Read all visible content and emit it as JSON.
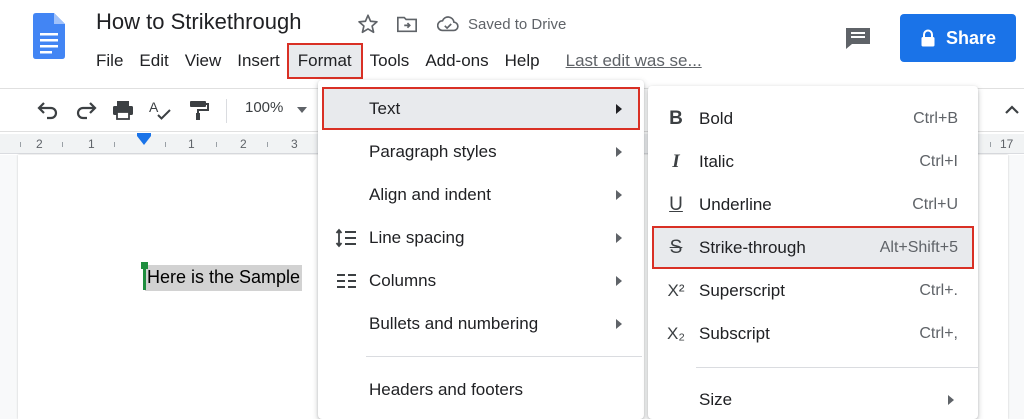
{
  "header": {
    "doc_title": "How to Strikethrough",
    "saved_status": "Saved to Drive",
    "share_label": "Share",
    "last_edit": "Last edit was se..."
  },
  "menubar": {
    "items": [
      "File",
      "Edit",
      "View",
      "Insert",
      "Format",
      "Tools",
      "Add-ons",
      "Help"
    ],
    "active": "Format"
  },
  "toolbar": {
    "zoom": "100%",
    "icons": [
      "undo-icon",
      "redo-icon",
      "print-icon",
      "spellcheck-icon",
      "paint-format-icon"
    ]
  },
  "ruler": {
    "numbers": [
      "2",
      "1",
      "1",
      "2",
      "3",
      "17"
    ]
  },
  "document": {
    "text": "Here is the Sample"
  },
  "format_menu": {
    "items": [
      {
        "label": "Text",
        "icon": "",
        "submenu": true,
        "highlighted": true
      },
      {
        "label": "Paragraph styles",
        "icon": "",
        "submenu": true
      },
      {
        "label": "Align and indent",
        "icon": "",
        "submenu": true
      },
      {
        "label": "Line spacing",
        "icon": "line-spacing-icon",
        "submenu": true
      },
      {
        "label": "Columns",
        "icon": "columns-icon",
        "submenu": true
      },
      {
        "label": "Bullets and numbering",
        "icon": "",
        "submenu": true
      },
      {
        "label": "Headers and footers",
        "icon": "",
        "submenu": false
      }
    ]
  },
  "text_menu": {
    "items": [
      {
        "label": "Bold",
        "glyph": "B",
        "shortcut": "Ctrl+B"
      },
      {
        "label": "Italic",
        "glyph": "I",
        "shortcut": "Ctrl+I"
      },
      {
        "label": "Underline",
        "glyph": "U",
        "shortcut": "Ctrl+U"
      },
      {
        "label": "Strike-through",
        "glyph": "S",
        "shortcut": "Alt+Shift+5",
        "highlighted": true
      },
      {
        "label": "Superscript",
        "glyph": "X²",
        "shortcut": "Ctrl+."
      },
      {
        "label": "Subscript",
        "glyph": "X₂",
        "shortcut": "Ctrl+,"
      },
      {
        "label": "Size",
        "glyph": "",
        "shortcut": ""
      }
    ]
  },
  "colors": {
    "accent": "#1a73e8",
    "highlight_outline": "#d93025",
    "menu_hover": "#e8eaed",
    "cursor": "#1e8e3e"
  }
}
